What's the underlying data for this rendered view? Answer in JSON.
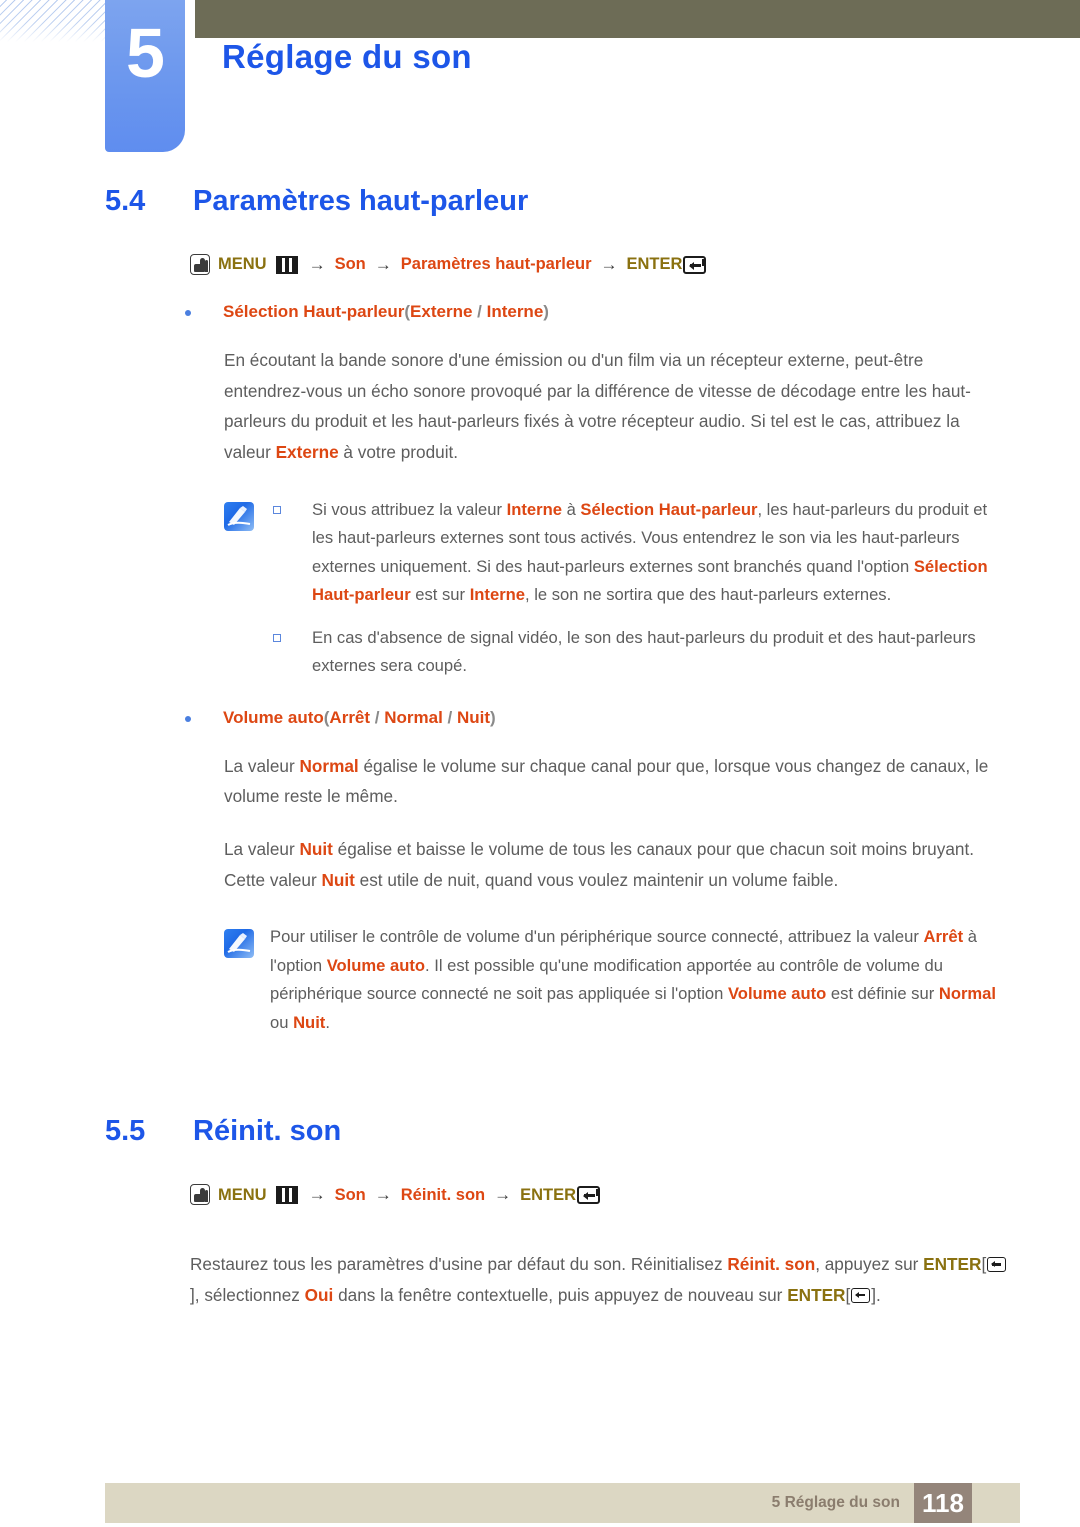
{
  "header": {
    "chapter_number": "5",
    "chapter_title": "Réglage du son",
    "accent_blue": "#1d56e8",
    "tab_blue": "#6e99ee",
    "olive_bar": "#6d6c56"
  },
  "sections": {
    "s54": {
      "number": "5.4",
      "name": "Paramètres haut-parleur",
      "menu_path": {
        "menu_label": "MENU",
        "arrow": "→",
        "item1": "Son",
        "item2": "Paramètres haut-parleur",
        "enter_label": "ENTER"
      },
      "bullet1": {
        "name": "Sélection Haut-parleur",
        "open_paren": "(",
        "opt1": "Externe",
        "slash": " / ",
        "opt2": "Interne",
        "close_paren": ")"
      },
      "paragraph1": {
        "part1": "En écoutant la bande sonore d'une émission ou d'un film via un récepteur externe, peut-être entendrez-vous un écho sonore provoqué par la différence de vitesse de décodage entre les haut-parleurs du produit et les haut-parleurs fixés à votre récepteur audio. Si tel est le cas, attribuez la valeur ",
        "hl1": "Externe",
        "part2": " à votre produit."
      },
      "note1": {
        "item1": {
          "p1": "Si vous attribuez la valeur ",
          "hl1": "Interne",
          "p2": " à ",
          "hl2": "Sélection Haut-parleur",
          "p3": ", les haut-parleurs du produit et les haut-parleurs externes sont tous activés. Vous entendrez le son via les haut-parleurs externes uniquement. Si des haut-parleurs externes sont branchés quand l'option ",
          "hl3": "Sélection Haut-parleur",
          "p4": " est sur ",
          "hl4": "Interne",
          "p5": ", le son ne sortira que des haut-parleurs externes."
        },
        "item2": {
          "p1": "En cas d'absence de signal vidéo, le son des haut-parleurs du produit et des haut-parleurs externes sera coupé."
        }
      },
      "bullet2": {
        "name": "Volume auto",
        "open_paren": "(",
        "opt1": "Arrêt",
        "slash1": " / ",
        "opt2": "Normal",
        "slash2": " / ",
        "opt3": "Nuit",
        "close_paren": ")"
      },
      "paragraph2": {
        "part1": "La valeur ",
        "hl1": "Normal",
        "part2": " égalise le volume sur chaque canal pour que, lorsque vous changez de canaux, le volume reste le même."
      },
      "paragraph3": {
        "part1": "La valeur ",
        "hl1": "Nuit",
        "part2": " égalise et baisse le volume de tous les canaux pour que chacun soit moins bruyant. Cette valeur ",
        "hl2": "Nuit",
        "part3": " est utile de nuit, quand vous voulez maintenir un volume faible."
      },
      "note2": {
        "p1": "Pour utiliser le contrôle de volume d'un périphérique source connecté, attribuez la valeur ",
        "hl1": "Arrêt",
        "p2": " à l'option ",
        "hl2": "Volume auto",
        "p3": ". Il est possible qu'une modification apportée au contrôle de volume du périphérique source connecté ne soit pas appliquée si l'option ",
        "hl3": "Volume auto",
        "p4": " est définie sur ",
        "hl4": "Normal",
        "p5": " ou ",
        "hl5": "Nuit",
        "p6": "."
      }
    },
    "s55": {
      "number": "5.5",
      "name": "Réinit. son",
      "menu_path": {
        "menu_label": "MENU",
        "arrow": "→",
        "item1": "Son",
        "item2": "Réinit. son",
        "enter_label": "ENTER"
      },
      "paragraph1": {
        "p1": "Restaurez tous les paramètres d'usine par défaut du son. Réinitialisez ",
        "hl1": "Réinit. son",
        "p2": ", appuyez sur ",
        "hl2": "ENTER",
        "bracket_open": "[",
        "bracket_close": "]",
        "p3": ", sélectionnez ",
        "hl3": "Oui",
        "p4": " dans la fenêtre contextuelle, puis appuyez de nouveau sur ",
        "hl4": "ENTER",
        "p5": "."
      }
    }
  },
  "footer": {
    "text": "5 Réglage du son",
    "page_number": "118",
    "bar_color": "#dcd7c3",
    "page_box_color": "#94857a"
  },
  "icons": {
    "touch": "touch-button-icon",
    "menu": "menu-bars-icon",
    "enter": "enter-return-icon",
    "note": "note-pencil-icon"
  }
}
